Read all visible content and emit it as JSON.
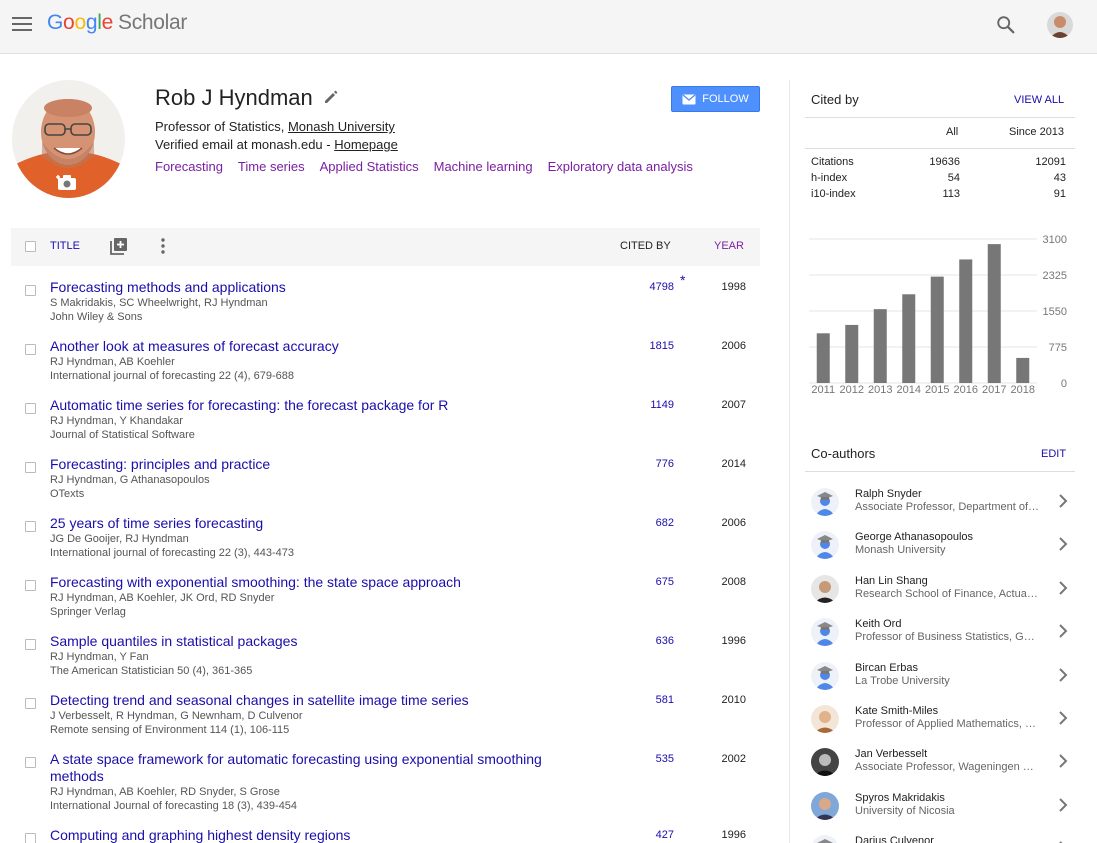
{
  "header": {
    "logo_letters": [
      "G",
      "o",
      "o",
      "g",
      "l",
      "e"
    ],
    "logo_product": "Scholar"
  },
  "profile": {
    "name": "Rob J Hyndman",
    "follow_label": "FOLLOW",
    "affiliation_prefix": "Professor of Statistics, ",
    "affiliation_link": "Monash University",
    "email_text": "Verified email at monash.edu - ",
    "homepage_link": "Homepage",
    "interests": [
      "Forecasting",
      "Time series",
      "Applied Statistics",
      "Machine learning",
      "Exploratory data analysis"
    ]
  },
  "table": {
    "col_title": "TITLE",
    "col_cited": "CITED BY",
    "col_year": "YEAR",
    "star_mark": "*",
    "articles": [
      {
        "title": "Forecasting methods and applications",
        "authors": "S Makridakis, SC Wheelwright, RJ Hyndman",
        "venue": "John Wiley & Sons",
        "cited": "4798",
        "year": "1998"
      },
      {
        "title": "Another look at measures of forecast accuracy",
        "authors": "RJ Hyndman, AB Koehler",
        "venue": "International journal of forecasting 22 (4), 679-688",
        "cited": "1815",
        "year": "2006"
      },
      {
        "title": "Automatic time series for forecasting: the forecast package for R",
        "authors": "RJ Hyndman, Y Khandakar",
        "venue": "Journal of Statistical Software",
        "cited": "1149",
        "year": "2007"
      },
      {
        "title": "Forecasting: principles and practice",
        "authors": "RJ Hyndman, G Athanasopoulos",
        "venue": "OTexts",
        "cited": "776",
        "year": "2014"
      },
      {
        "title": "25 years of time series forecasting",
        "authors": "JG De Gooijer, RJ Hyndman",
        "venue": "International journal of forecasting 22 (3), 443-473",
        "cited": "682",
        "year": "2006"
      },
      {
        "title": "Forecasting with exponential smoothing: the state space approach",
        "authors": "RJ Hyndman, AB Koehler, JK Ord, RD Snyder",
        "venue": "Springer Verlag",
        "cited": "675",
        "year": "2008"
      },
      {
        "title": "Sample quantiles in statistical packages",
        "authors": "RJ Hyndman, Y Fan",
        "venue": "The American Statistician 50 (4), 361-365",
        "cited": "636",
        "year": "1996"
      },
      {
        "title": "Detecting trend and seasonal changes in satellite image time series",
        "authors": "J Verbesselt, R Hyndman, G Newnham, D Culvenor",
        "venue": "Remote sensing of Environment 114 (1), 106-115",
        "cited": "581",
        "year": "2010"
      },
      {
        "title": "A state space framework for automatic forecasting using exponential smoothing methods",
        "authors": "RJ Hyndman, AB Koehler, RD Snyder, S Grose",
        "venue": "International Journal of forecasting 18 (3), 439-454",
        "cited": "535",
        "year": "2002"
      },
      {
        "title": "Computing and graphing highest density regions",
        "authors": "",
        "venue": "",
        "cited": "427",
        "year": "1996"
      }
    ]
  },
  "cited_by": {
    "title": "Cited by",
    "view_all": "VIEW ALL",
    "col_all": "All",
    "col_since": "Since 2013",
    "rows": [
      {
        "label": "Citations",
        "all": "19636",
        "since": "12091"
      },
      {
        "label": "h-index",
        "all": "54",
        "since": "43"
      },
      {
        "label": "i10-index",
        "all": "113",
        "since": "91"
      }
    ]
  },
  "chart_data": {
    "type": "bar",
    "categories": [
      "2011",
      "2012",
      "2013",
      "2014",
      "2015",
      "2016",
      "2017",
      "2018"
    ],
    "values": [
      1070,
      1250,
      1590,
      1910,
      2290,
      2660,
      2990,
      540
    ],
    "ylim": [
      0,
      3100
    ],
    "yticks": [
      "3100",
      "2325",
      "1550",
      "775",
      "0"
    ],
    "bar_color": "#777777",
    "grid": true
  },
  "coauthors": {
    "title": "Co-authors",
    "edit": "EDIT",
    "list": [
      {
        "name": "Ralph Snyder",
        "affil": "Associate Professor, Department of Econometrics",
        "avatar": "default"
      },
      {
        "name": "George Athanasopoulos",
        "affil": "Monash University",
        "avatar": "default"
      },
      {
        "name": "Han Lin Shang",
        "affil": "Research School of Finance, Actuarial Studies",
        "avatar": "photo-dark"
      },
      {
        "name": "Keith Ord",
        "affil": "Professor of Business Statistics, Georgetown",
        "avatar": "default"
      },
      {
        "name": "Bircan Erbas",
        "affil": "La Trobe University",
        "avatar": "default"
      },
      {
        "name": "Kate Smith-Miles",
        "affil": "Professor of Applied Mathematics, University",
        "avatar": "photo-warm"
      },
      {
        "name": "Jan Verbesselt",
        "affil": "Associate Professor, Wageningen University",
        "avatar": "photo-bw"
      },
      {
        "name": "Spyros Makridakis",
        "affil": "University of Nicosia",
        "avatar": "photo-blue"
      },
      {
        "name": "Darius Culvenor",
        "affil": "",
        "avatar": "default"
      }
    ]
  },
  "colors": {
    "link": "#1a0dab",
    "interest": "#7b1fa2",
    "follow_bg": "#4d90fe",
    "bar": "#777777"
  }
}
